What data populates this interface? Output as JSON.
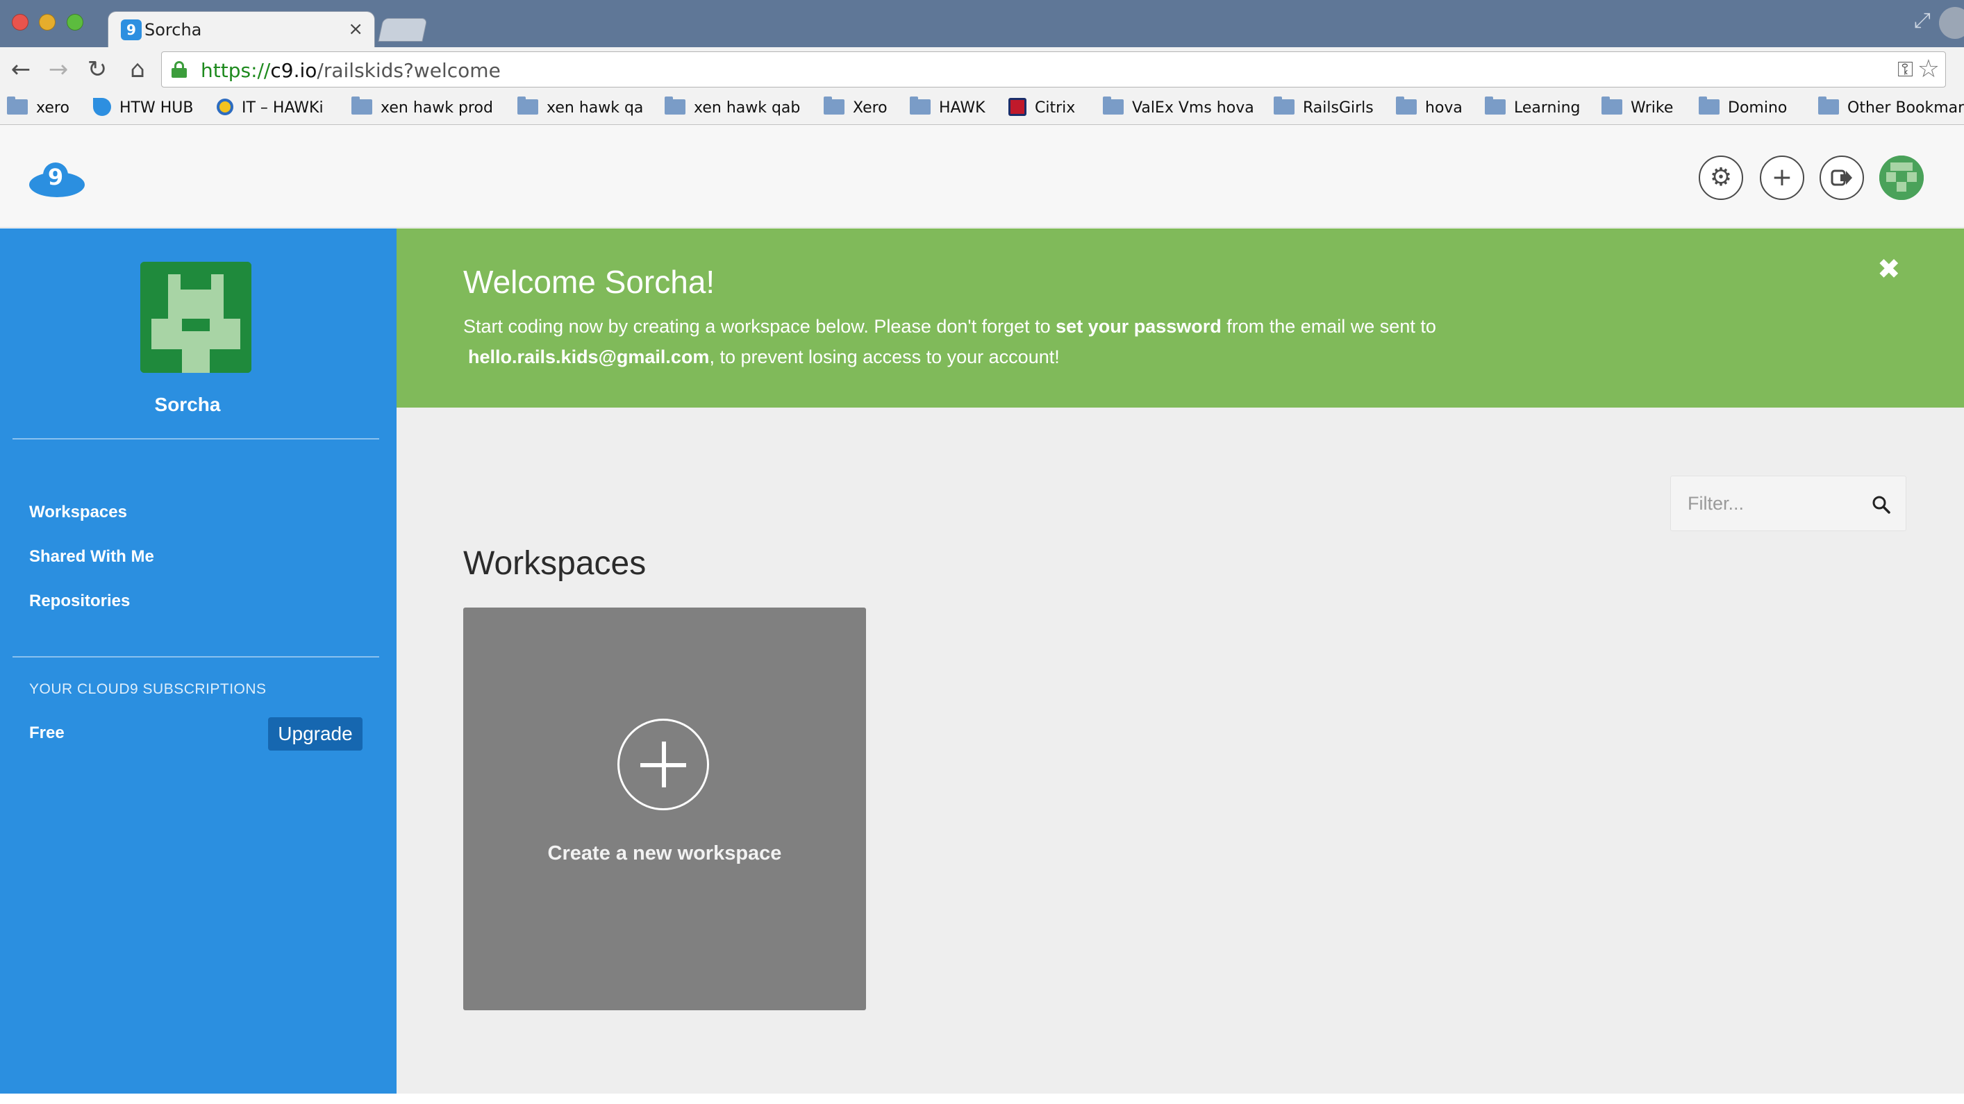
{
  "browser": {
    "tab_title": "Sorcha",
    "tab_close": "×",
    "url_scheme": "https://",
    "url_host": "c9.io",
    "url_path": "/railskids?welcome",
    "bookmarks": [
      "xero",
      "HTW HUB",
      "IT – HAWKi",
      "xen hawk prod",
      "xen hawk qa",
      "xen hawk qab",
      "Xero",
      "HAWK",
      "Citrix",
      "ValEx Vms hova",
      "RailsGirls",
      "hova",
      "Learning",
      "Wrike",
      "Domino",
      "Other Bookmar"
    ]
  },
  "app": {
    "brand_color": "#2b8fe0",
    "sidebar": {
      "username": "Sorcha",
      "links": [
        "Workspaces",
        "Shared With Me",
        "Repositories"
      ],
      "subscriptions_title": "YOUR CLOUD9 SUBSCRIPTIONS",
      "plan": "Free",
      "upgrade_label": "Upgrade"
    },
    "welcome": {
      "title": "Welcome Sorcha!",
      "line1_pre": "Start coding now by creating a workspace below. Please don't forget to ",
      "line1_bold": "set your password",
      "line1_post": " from the email we sent to",
      "email": "hello.rails.kids@gmail.com",
      "line2_post": ", to prevent losing access to your account!",
      "close": "✖"
    },
    "filter_placeholder": "Filter...",
    "workspaces_heading": "Workspaces",
    "new_workspace_label": "Create a new workspace"
  }
}
